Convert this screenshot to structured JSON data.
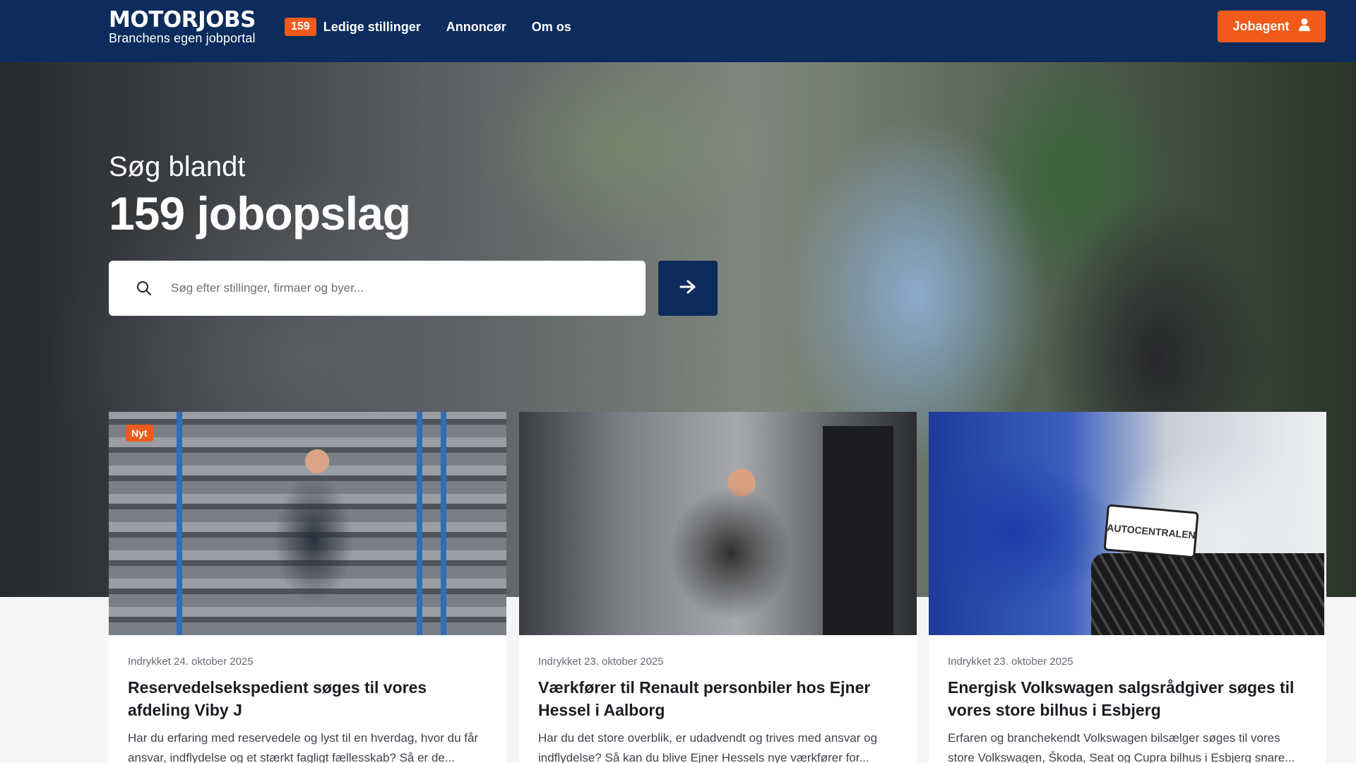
{
  "header": {
    "logo_title": "MOTORJOBS",
    "logo_subtitle": "Branchens egen jobportal",
    "job_count_badge": "159",
    "nav": {
      "jobs_label": "Ledige stillinger",
      "advertise_label": "Annoncør",
      "about_label": "Om os"
    },
    "jobagent_label": "Jobagent"
  },
  "hero": {
    "pretitle": "Søg blandt",
    "title": "159 jobopslag",
    "search_placeholder": "Søg efter stillinger, firmaer og byer..."
  },
  "cards": [
    {
      "badge": "Nyt",
      "date": "Indrykket 24. oktober 2025",
      "title": "Reservedelsekspedient søges til vores afdeling Viby J",
      "description": "Har du erfaring med reservedele og lyst til en hverdag, hvor du får ansvar, indflydelse og et stærkt fagligt fællesskab? Så er de..."
    },
    {
      "date": "Indrykket 23. oktober 2025",
      "title": "Værkfører til Renault personbiler hos Ejner Hessel i Aalborg",
      "description": "Har du det store overblik, er udadvendt og trives med ansvar og indflydelse? Så kan du blive Ejner Hessels nye værkfører for..."
    },
    {
      "date": "Indrykket 23. oktober 2025",
      "title": "Energisk Volkswagen salgsrådgiver søges til vores store bilhus i Esbjerg",
      "description": "Erfaren og branchekendt Volkswagen bilsælger søges til vores store Volkswagen, Škoda, Seat og Cupra bilhus i Esbjerg snare...",
      "plate_text": "AUTOCENTRALEN"
    }
  ],
  "colors": {
    "navy": "#0b2c5c",
    "accent_orange": "#f05a1a"
  }
}
